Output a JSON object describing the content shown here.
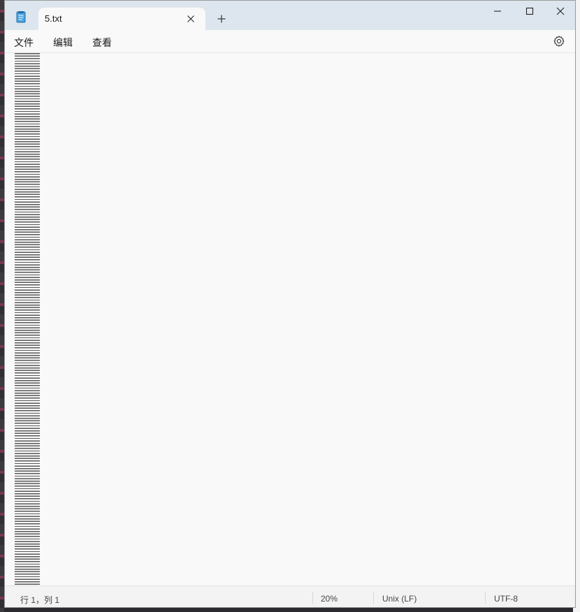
{
  "window": {
    "tab_title": "5.txt",
    "app_icon": "notepad-icon",
    "tab_close_icon": "close-icon",
    "new_tab_icon": "plus-icon",
    "minimize_icon": "minimize-icon",
    "maximize_icon": "maximize-icon",
    "close_icon": "close-icon"
  },
  "menu": {
    "items": [
      "文件",
      "编辑",
      "查看"
    ],
    "settings_icon": "gear-icon"
  },
  "status": {
    "cursor": "行 1，列 1",
    "zoom": "20%",
    "line_ending": "Unix (LF)",
    "encoding": "UTF-8"
  },
  "colors": {
    "titlebar": "#dde6ee",
    "editor_bg": "#f9f9f9",
    "statusbar": "#f3f3f3"
  }
}
